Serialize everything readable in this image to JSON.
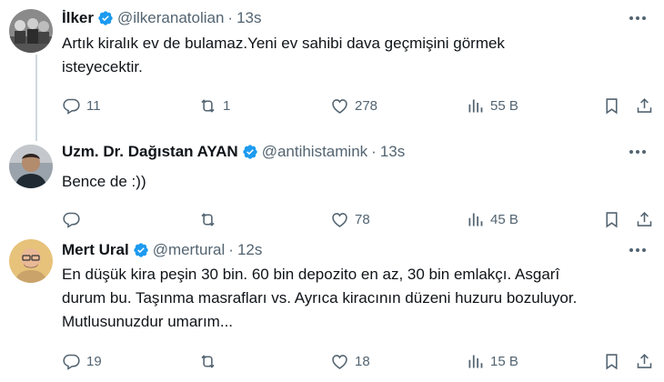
{
  "tweets": [
    {
      "name": "İlker",
      "handle": "@ilkeranatolian",
      "dot": "·",
      "time": "13s",
      "text": "Artık kiralık ev de bulamaz.Yeni ev sahibi dava geçmişini görmek isteyecektir.",
      "reply_count": "11",
      "retweet_count": "1",
      "like_count": "278",
      "view_count": "55 B"
    },
    {
      "name": "Uzm. Dr. Dağıstan AYAN",
      "handle": "@antihistamink",
      "dot": "·",
      "time": "13s",
      "text": "Bence de :))",
      "reply_count": "",
      "retweet_count": "",
      "like_count": "78",
      "view_count": "45 B"
    },
    {
      "name": "Mert Ural",
      "handle": "@mertural",
      "dot": "·",
      "time": "12s",
      "text_lines": [
        "En düşük kira peşin 30 bin. 60 bin depozito en az, 30 bin emlakçı. Asgarî",
        "durum bu. Taşınma masrafları vs. Ayrıca kiracının düzeni huzuru bozuluyor.",
        "Mutlusunuzdur umarım..."
      ],
      "reply_count": "19",
      "retweet_count": "",
      "like_count": "18",
      "view_count": "15 B"
    }
  ],
  "colors": {
    "verified": "#1d9bf0",
    "muted": "#536471",
    "text": "#0f1419",
    "thread_line": "#cfd9de"
  },
  "icons": [
    "verified-badge-icon",
    "more-icon",
    "reply-icon",
    "retweet-icon",
    "like-icon",
    "views-icon",
    "bookmark-icon",
    "share-icon"
  ]
}
